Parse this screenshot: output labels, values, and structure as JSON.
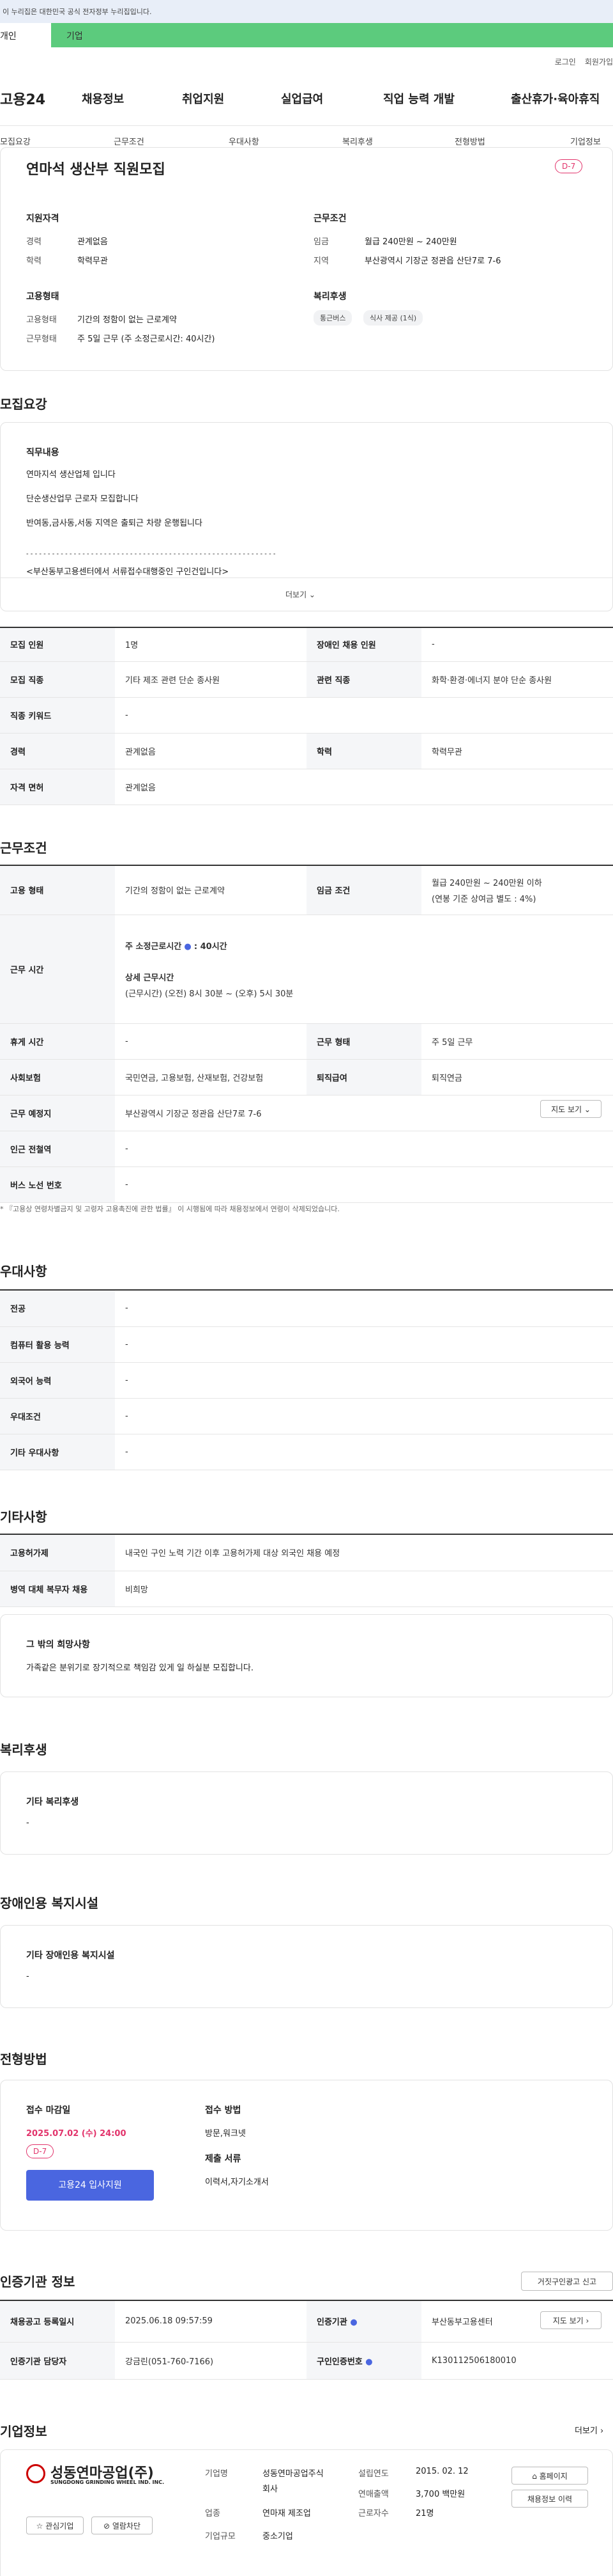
{
  "gov_banner": "이 누리집은 대한민국 공식 전자정부 누리집입니다.",
  "top_tabs": [
    "개인",
    "기업"
  ],
  "util": [
    "로그인",
    "회원가입"
  ],
  "logo": "고용24",
  "gnb": [
    "채용정보",
    "취업지원",
    "실업급여",
    "직업 능력 개발",
    "출산휴가·육아휴직"
  ],
  "anchors": [
    "모집요강",
    "근무조건",
    "우대사항",
    "복리후생",
    "전형방법",
    "기업정보"
  ],
  "job": {
    "title": "연마석 생산부 직원모집",
    "dday": "D-7",
    "qual_h": "지원자격",
    "cond_h": "근무조건",
    "emp_h": "고용형태",
    "welfare_h": "복리후생",
    "career_k": "경력",
    "career_v": "관계없음",
    "edu_k": "학력",
    "edu_v": "학력무관",
    "wage_k": "임금",
    "wage_v": "월급 240만원 ~ 240만원",
    "loc_k": "지역",
    "loc_v": "부산광역시 기장군 정관읍 산단7로 7-6",
    "etype_k": "고용형태",
    "etype_v": "기간의 정함이 없는 근로계약",
    "wtype_k": "근무형태",
    "wtype_v": "주 5일 근무 (주 소정근로시간: 40시간)",
    "welfare": [
      "통근버스",
      "식사 제공 (1식)"
    ]
  },
  "recruit": {
    "section": "모집요강",
    "duty_h": "직무내용",
    "duty_lines": [
      "연마지석 생산업체 입니다",
      "단순생산업무 근로자 모집합니다",
      "반여동,금사동,서동 지역은 출퇴근 차량 운행됩니다",
      "- - - - - - - - - - - - - - - - - - - - - - - - - - - - - - - - - - - - - - - - - - - - - - - - - - - - - - - - - -",
      "<부산동부고용센터에서 서류접수대행중인 구인건입니다>"
    ],
    "more": "더보기 ⌄",
    "rows": [
      [
        "모집 인원",
        "1명",
        "장애인 채용 인원",
        "-"
      ],
      [
        "모집 직종",
        "기타 제조 관련 단순 종사원",
        "관련 직종",
        "화학·환경·에너지 분야 단순 종사원"
      ],
      [
        "직종 키워드",
        "-",
        "",
        ""
      ],
      [
        "경력",
        "관계없음",
        "학력",
        "학력무관"
      ],
      [
        "자격 면허",
        "관계없음",
        "",
        ""
      ]
    ]
  },
  "work": {
    "section": "근무조건",
    "etype_k": "고용 형태",
    "etype_v": "기간의 정함이 없는 근로계약",
    "wage_k": "임금 조건",
    "wage_v1": "월급 240만원 ~ 240만원 이하",
    "wage_v2": "(연봉 기준 상여금 별도 : 4%)",
    "hours_k": "근무 시간",
    "hours_a": "주 소정근로시간",
    "hours_a_val": ": 40시간",
    "hours_b": "상세 근무시간",
    "hours_b_val": "(근무시간) (오전) 8시 30분 ~ (오후) 5시 30분",
    "rest_k": "휴게 시간",
    "rest_v": "-",
    "wform_k": "근무 형태",
    "wform_v": "주 5일 근무",
    "ins_k": "사회보험",
    "ins_v": "국민연금, 고용보험, 산재보험, 건강보험",
    "ret_k": "퇴직급여",
    "ret_v": "퇴직연금",
    "place_k": "근무 예정지",
    "place_v": "부산광역시 기장군 정관읍 산단7로 7-6",
    "map_btn": "지도 보기 ⌄",
    "sub_k": "인근 전철역",
    "sub_v": "-",
    "bus_k": "버스 노선 번호",
    "bus_v": "-",
    "note": "* 『고용상 연령차별금지 및 고령자 고용촉진에 관한 법률』 이 시행됨에 따라 채용정보에서 연령이 삭제되었습니다."
  },
  "pref": {
    "section": "우대사항",
    "rows": [
      [
        "전공",
        "-"
      ],
      [
        "컴퓨터 활용 능력",
        "-"
      ],
      [
        "외국어 능력",
        "-"
      ],
      [
        "우대조건",
        "-"
      ],
      [
        "기타 우대사항",
        "-"
      ]
    ]
  },
  "etc": {
    "section": "기타사항",
    "rows": [
      [
        "고용허가제",
        "내국인 구인 노력 기간 이후 고용허가제 대상 외국인 채용 예정"
      ],
      [
        "병역 대체 복무자 채용",
        "비희망"
      ]
    ],
    "box_h": "그 밖의 희망사항",
    "box_v": "가족같은 분위기로 장기적으로 책임감 있게 일 하실분 모집합니다."
  },
  "welfare": {
    "section": "복리후생",
    "box_h": "기타 복리후생",
    "box_v": "-"
  },
  "disab": {
    "section": "장애인용 복지시설",
    "box_h": "기타 장애인용 복지시설",
    "box_v": "-"
  },
  "apply": {
    "section": "전형방법",
    "deadline_h": "접수 마감일",
    "deadline_v": "2025.07.02 (수) 24:00",
    "dday": "D-7",
    "btn": "고용24 입사지원",
    "method_h": "접수 방법",
    "method_v": "방문,워크넷",
    "docs_h": "제출 서류",
    "docs_v": "이력서,자기소개서"
  },
  "cert": {
    "section": "인증기관 정보",
    "report_btn": "거짓구인광고 신고",
    "reg_k": "채용공고 등록일시",
    "reg_v": "2025.06.18 09:57:59",
    "org_k": "인증기관",
    "org_v": "부산동부고용센터",
    "map_btn": "지도 보기 ›",
    "mgr_k": "인증기관 담당자",
    "mgr_v": "강금린(051-760-7166)",
    "no_k": "구인인증번호",
    "no_v": "K130112506180010"
  },
  "company": {
    "section": "기업정보",
    "more": "더보기 ›",
    "logo_kr": "성동연마공업(주)",
    "logo_en": "SUNGDONG GRINDING WHEEL IND. INC.",
    "interest": "☆ 관심기업",
    "block": "⊘ 열람차단",
    "name_k": "기업명",
    "name_v1": "성동연마공업주식",
    "name_v2": "회사",
    "ind_k": "업종",
    "ind_v": "연마재 제조업",
    "size_k": "기업규모",
    "size_v": "중소기업",
    "est_k": "설립연도",
    "est_v": "2015. 02. 12",
    "sales_k": "연매출액",
    "sales_v": "3,700 백만원",
    "emp_k": "근로자수",
    "emp_v": "21명",
    "home_btn": "⌂ 홈페이지",
    "info_btn": "채용정보 이력"
  }
}
